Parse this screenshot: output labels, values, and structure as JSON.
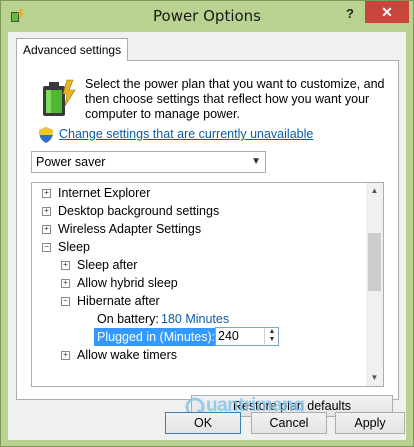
{
  "window": {
    "title": "Power Options",
    "help_label": "?",
    "close_label": "✕"
  },
  "tabs": [
    {
      "label": "Advanced settings"
    }
  ],
  "description": "Select the power plan that you want to customize, and then choose settings that reflect how you want your computer to manage power.",
  "change_link": "Change settings that are currently unavailable",
  "plan_select": {
    "value": "Power saver",
    "arrow": "▼"
  },
  "tree": {
    "items": [
      {
        "label": "Internet Explorer",
        "expander": "+"
      },
      {
        "label": "Desktop background settings",
        "expander": "+"
      },
      {
        "label": "Wireless Adapter Settings",
        "expander": "+"
      },
      {
        "label": "Sleep",
        "expander": "−"
      },
      {
        "label": "Sleep after",
        "expander": "+"
      },
      {
        "label": "Allow hybrid sleep",
        "expander": "+"
      },
      {
        "label": "Hibernate after",
        "expander": "−"
      },
      {
        "label": "On battery:",
        "value": "180 Minutes"
      },
      {
        "label": "Plugged in (Minutes):",
        "value": "240"
      },
      {
        "label": "Allow wake timers",
        "expander": "+"
      }
    ]
  },
  "scrollbar": {
    "up": "▲",
    "down": "▼"
  },
  "spinner": {
    "up": "▲",
    "down": "▼"
  },
  "buttons": {
    "restore": "Restore plan defaults",
    "ok": "OK",
    "cancel": "Cancel",
    "apply": "Apply"
  },
  "watermark": "uantrimang",
  "colors": {
    "accent": "#3399ff",
    "link": "#0b5cad",
    "frame": "#b9d28f",
    "close": "#c7453a"
  }
}
